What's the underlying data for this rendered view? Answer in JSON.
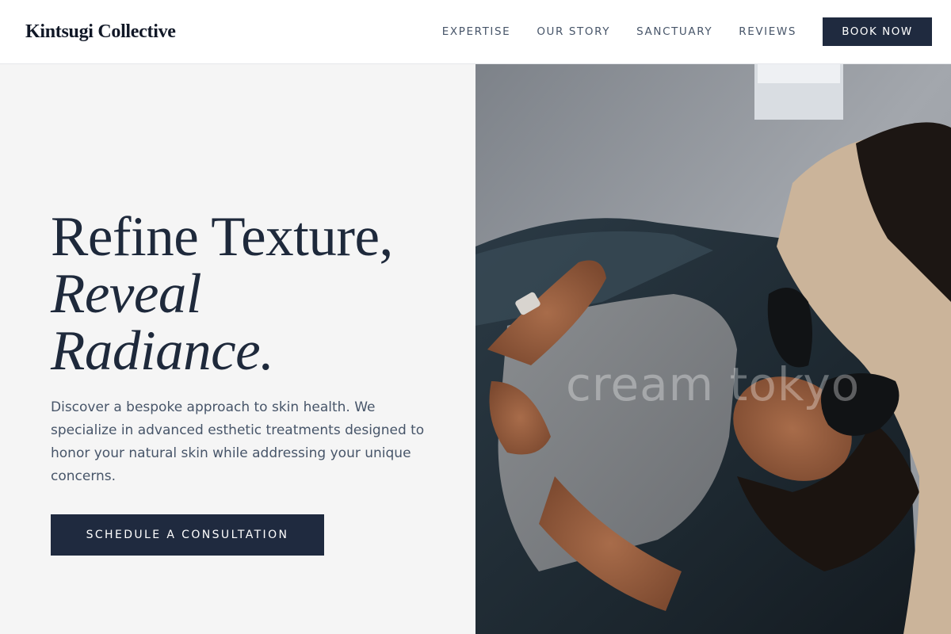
{
  "header": {
    "brand": "Kintsugi Collective",
    "nav": [
      {
        "label": "EXPERTISE"
      },
      {
        "label": "OUR STORY"
      },
      {
        "label": "SANCTUARY"
      },
      {
        "label": "REVIEWS"
      }
    ],
    "book_label": "BOOK NOW"
  },
  "hero": {
    "headline_line1": "Refine Texture,",
    "headline_line2": "Reveal",
    "headline_line3": "Radiance.",
    "description": "Discover a bespoke approach to skin health. We specialize in advanced esthetic treatments designed to honor your natural skin while addressing your unique concerns.",
    "cta_label": "SCHEDULE A CONSULTATION"
  },
  "photo": {
    "watermark": "cream tokyo",
    "subject": "esthetician performing facial treatment on client lying on treatment bed"
  },
  "colors": {
    "primary_dark": "#1f2a3f",
    "panel_bg": "#f5f5f5",
    "body_text": "#475569"
  }
}
